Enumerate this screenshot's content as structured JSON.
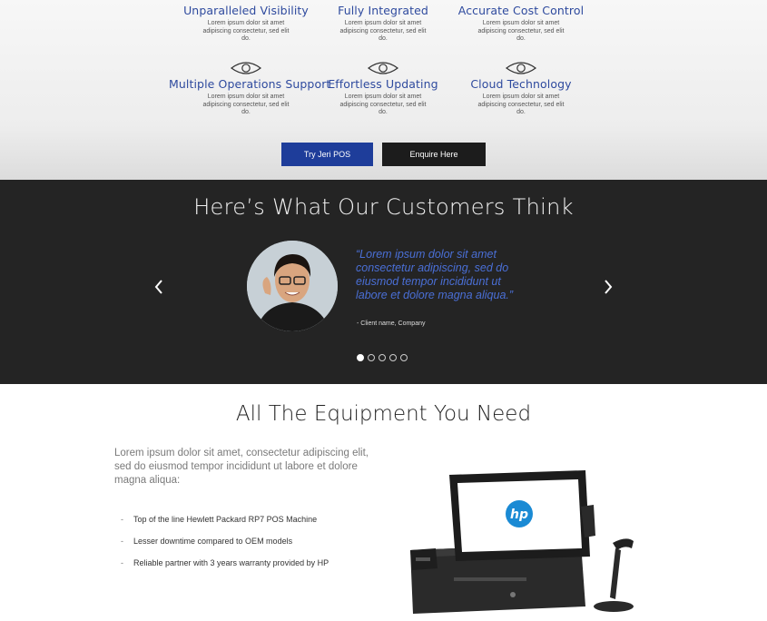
{
  "features": [
    {
      "title": "Unparalleled Visibility",
      "desc": "Lorem ipsum dolor sit amet adipiscing consectetur, sed elit do.",
      "icon": "eye-icon"
    },
    {
      "title": "Fully Integrated",
      "desc": "Lorem ipsum dolor sit amet adipiscing consectetur, sed elit do.",
      "icon": "eye-icon"
    },
    {
      "title": "Accurate Cost Control",
      "desc": "Lorem ipsum dolor sit amet adipiscing consectetur, sed elit do.",
      "icon": "eye-icon"
    },
    {
      "title": "Multiple Operations Support",
      "desc": "Lorem ipsum dolor sit amet adipiscing consectetur, sed elit do.",
      "icon": "eye-icon"
    },
    {
      "title": "Effortless Updating",
      "desc": "Lorem ipsum dolor sit amet adipiscing consectetur, sed elit do.",
      "icon": "eye-icon"
    },
    {
      "title": "Cloud Technology",
      "desc": "Lorem ipsum dolor sit amet adipiscing consectetur, sed elit do.",
      "icon": "eye-icon"
    }
  ],
  "buttons": {
    "try": "Try Jeri POS",
    "enquire": "Enquire Here"
  },
  "testimonials": {
    "heading": "Here’s What Our Customers Think",
    "quote": "“Lorem ipsum dolor sit amet consectetur adipiscing, sed do eiusmod tempor incididunt ut labore et dolore magna aliqua.”",
    "client": "- Client name, Company",
    "slide_count": 5,
    "active_slide": 1
  },
  "equipment": {
    "heading": "All The Equipment You Need",
    "intro": "Lorem ipsum dolor sit amet, consectetur adipiscing elit, sed do eiusmod tempor incididunt ut labore et dolore magna aliqua:",
    "items": [
      "Top of the line Hewlett Packard RP7 POS Machine",
      "Lesser downtime compared to OEM models",
      "Reliable partner with 3 years warranty provided by HP"
    ],
    "screen_logo": "hp"
  },
  "colors": {
    "accent_blue": "#1e3d9a",
    "feature_title": "#2e4a9e",
    "quote_blue": "#4a6fd6",
    "dark_band": "#242424"
  }
}
